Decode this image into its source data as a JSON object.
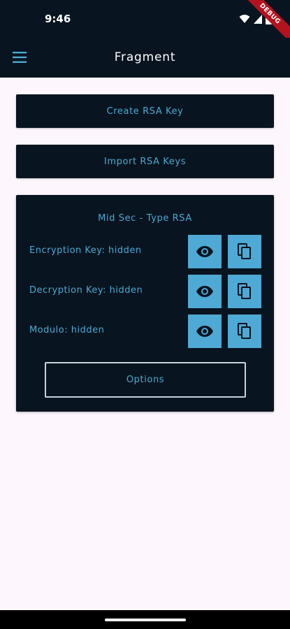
{
  "status_bar": {
    "time": "9:46",
    "debug_label": "DEBUG"
  },
  "app_bar": {
    "title": "Fragment",
    "menu_icon": "hamburger-menu-icon"
  },
  "actions": {
    "create_label": "Create RSA Key",
    "import_label": "Import RSA Keys"
  },
  "card": {
    "title": "Mid Sec - Type RSA",
    "rows": [
      {
        "label": "Encryption Key: hidden"
      },
      {
        "label": "Decryption Key: hidden"
      },
      {
        "label": "Modulo: hidden"
      }
    ],
    "options_label": "Options"
  },
  "colors": {
    "dark": "#08141f",
    "accent": "#4ea9d4",
    "background": "#fdf7fd"
  }
}
